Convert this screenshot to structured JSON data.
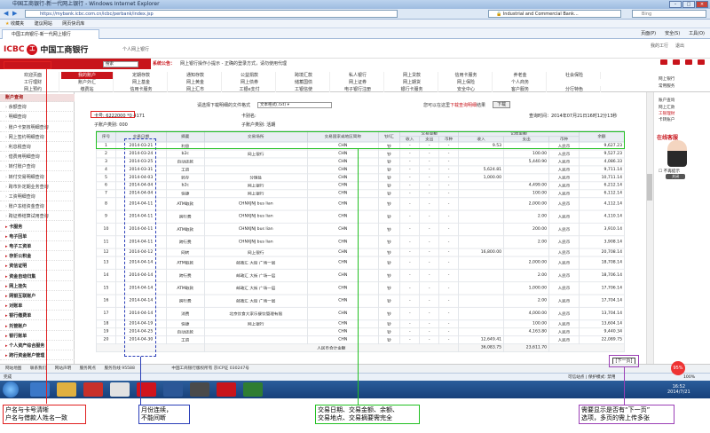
{
  "browser": {
    "window_title": "中国工商银行-新一代网上银行 - Windows Internet Explorer",
    "address": "https://mybank.icbc.com.cn/icbc/perbank/index.jsp",
    "cert_text": "Industrial and Commercial Bank...",
    "search_placeholder": "Bing",
    "favorites": [
      "收藏夹",
      "建议网站",
      "网页快讯库"
    ],
    "tab_title": "中国工商银行-新一代网上银行",
    "commands": [
      "页面(P)",
      "安全(S)",
      "工具(O)"
    ]
  },
  "header": {
    "logo_cn": "中国工商银行",
    "logo_en": "ICBC",
    "greeting": "个人网上银行",
    "links": [
      "我的工行",
      "退出"
    ],
    "search_label": "搜索",
    "notice_label": "系统公告：",
    "notice_text": "网上银行操作小提示 - 正确的登录方式，请勿使用代理"
  },
  "nav": {
    "row1": [
      "欢迎页面",
      "我的账户",
      "定期存款",
      "通知存款",
      "公益捐款",
      "跨境汇款",
      "私人银行",
      "网上贷款",
      "信用卡服务",
      "养老金",
      "社会保险"
    ],
    "row2": [
      "工行理财",
      "账户外汇",
      "网上基金",
      "网上黄金",
      "网上债券",
      "储蓄国债",
      "网上证券",
      "网上期货",
      "网上保险",
      "个人商务"
    ],
    "row3": [
      "网上预约",
      "缴费站",
      "信用卡服务",
      "网上汇市",
      "工银e支付",
      "工银信使",
      "电子银行注册",
      "银行卡服务",
      "安全中心",
      "客户服务",
      "分行特色"
    ],
    "active": "我的账户"
  },
  "sidebar": {
    "items": [
      {
        "label": "账户查询",
        "kind": "head"
      },
      {
        "label": "余额查询",
        "kind": "sub"
      },
      {
        "label": "明细查询",
        "kind": "sub"
      },
      {
        "label": "账户卡复核明细查询",
        "kind": "sub"
      },
      {
        "label": "网上签约明细查询",
        "kind": "sub"
      },
      {
        "label": "利息税查询",
        "kind": "sub"
      },
      {
        "label": "借费用明细查询",
        "kind": "sub"
      },
      {
        "label": "转付账户查询",
        "kind": "sub"
      },
      {
        "label": "转付交易明细查询",
        "kind": "sub"
      },
      {
        "label": "跨市外定期业务查询",
        "kind": "sub"
      },
      {
        "label": "工资明细查询",
        "kind": "sub"
      },
      {
        "label": "账户冻结资金查询",
        "kind": "sub"
      },
      {
        "label": "跨证券结算试用查询",
        "kind": "sub"
      },
      {
        "label": "卡服务",
        "kind": "sec"
      },
      {
        "label": "电子回单",
        "kind": "sec"
      },
      {
        "label": "电子工资单",
        "kind": "sec"
      },
      {
        "label": "存折公积金",
        "kind": "sec"
      },
      {
        "label": "资信证明",
        "kind": "sec"
      },
      {
        "label": "资金自动归集",
        "kind": "sec"
      },
      {
        "label": "网上挂失",
        "kind": "sec"
      },
      {
        "label": "网银互联账户",
        "kind": "sec"
      },
      {
        "label": "对账单",
        "kind": "sec"
      },
      {
        "label": "银行缴费单",
        "kind": "sec"
      },
      {
        "label": "托管账户",
        "kind": "sec"
      },
      {
        "label": "银行账单",
        "kind": "sec"
      },
      {
        "label": "个人资产综合服务",
        "kind": "sec"
      },
      {
        "label": "跨行资金账户管理",
        "kind": "sec"
      }
    ]
  },
  "main": {
    "download_label": "请选择下载明细的文件格式",
    "download_format": "文本格式(.txt)",
    "download_tip_pre": "您可以在这里",
    "download_tip_link": "下载查询明细",
    "download_tip_post": "结果",
    "download_button": "下载",
    "account_no": "卡号: 6222000 *0 4171",
    "account_type": "子账户类别: 000",
    "account_alias": "卡别名:",
    "account_kind": "子账户类别: 活期",
    "query_time": "查询时间：2014年07月21日16时12分13秒",
    "columns": {
      "no": "序号",
      "date": "交易日期",
      "summary": "摘要",
      "place": "交易场所",
      "country": "交易国家或地区简称",
      "cash": "钞/汇",
      "txn_amount": "交易金额",
      "rec_amount": "记账金额",
      "income": "收入",
      "expense": "支出",
      "currency": "币种",
      "balance": "余额"
    },
    "rows": [
      {
        "no": "1",
        "date": "2014-03-21",
        "summary": "利息",
        "place": "",
        "country": "CHN",
        "cash": "钞",
        "t_in": "-",
        "t_out": "-",
        "t_cur": "-",
        "r_in": "9.53",
        "r_out": "",
        "r_cur": "人民币",
        "balance": "9,627.23"
      },
      {
        "no": "2",
        "date": "2014-03-24",
        "summary": "b2c",
        "place": "网上银行",
        "country": "CHN",
        "cash": "钞",
        "t_in": "-",
        "t_out": "-",
        "t_cur": "-",
        "r_in": "",
        "r_out": "100.00",
        "r_cur": "人民币",
        "balance": "9,527.23"
      },
      {
        "no": "3",
        "date": "2014-03-25",
        "summary": "自动还款",
        "place": "",
        "country": "CHN",
        "cash": "钞",
        "t_in": "-",
        "t_out": "-",
        "t_cur": "-",
        "r_in": "",
        "r_out": "5,440.90",
        "r_cur": "人民币",
        "balance": "4,086.33"
      },
      {
        "no": "4",
        "date": "2014-03-31",
        "summary": "工资",
        "place": "",
        "country": "CHN",
        "cash": "钞",
        "t_in": "-",
        "t_out": "-",
        "t_cur": "-",
        "r_in": "5,624.81",
        "r_out": "",
        "r_cur": "人民币",
        "balance": "9,711.14"
      },
      {
        "no": "5",
        "date": "2014-04-03",
        "summary": "转存",
        "place": "分理处",
        "country": "CHN",
        "cash": "钞",
        "t_in": "-",
        "t_out": "-",
        "t_cur": "-",
        "r_in": "1,000.00",
        "r_out": "",
        "r_cur": "人民币",
        "balance": "10,711.14"
      },
      {
        "no": "6",
        "date": "2014-04-04",
        "summary": "b2c",
        "place": "网上银行",
        "country": "CHN",
        "cash": "钞",
        "t_in": "-",
        "t_out": "-",
        "t_cur": "-",
        "r_in": "",
        "r_out": "4,499.00",
        "r_cur": "人民币",
        "balance": "6,212.14"
      },
      {
        "no": "7",
        "date": "2014-04-04",
        "summary": "快捷",
        "place": "网上银行",
        "country": "CHN",
        "cash": "钞",
        "t_in": "-",
        "t_out": "-",
        "t_cur": "-",
        "r_in": "",
        "r_out": "100.00",
        "r_cur": "人民币",
        "balance": "6,112.14"
      },
      {
        "no": "8",
        "date": "2014-04-11",
        "summary": "ATM取款",
        "place": "CHNXJNJ bus lian",
        "country": "CHN",
        "cash": "钞",
        "t_in": "-",
        "t_out": "-",
        "t_cur": "-",
        "r_in": "",
        "r_out": "2,000.00",
        "r_cur": "人民币",
        "balance": "4,112.14"
      },
      {
        "no": "9",
        "date": "2014-04-11",
        "summary": "跨行费",
        "place": "CHNXJNJ bus lian",
        "country": "CHN",
        "cash": "钞",
        "t_in": "-",
        "t_out": "-",
        "t_cur": "-",
        "r_in": "",
        "r_out": "2.00",
        "r_cur": "人民币",
        "balance": "4,110.14"
      },
      {
        "no": "10",
        "date": "2014-04-11",
        "summary": "ATM取款",
        "place": "CHNXJNJ bus lian",
        "country": "CHN",
        "cash": "钞",
        "t_in": "-",
        "t_out": "-",
        "t_cur": "-",
        "r_in": "",
        "r_out": "200.00",
        "r_cur": "人民币",
        "balance": "3,910.14"
      },
      {
        "no": "11",
        "date": "2014-04-11",
        "summary": "跨行费",
        "place": "CHNXJNJ bus lian",
        "country": "CHN",
        "cash": "钞",
        "t_in": "-",
        "t_out": "-",
        "t_cur": "-",
        "r_in": "",
        "r_out": "2.00",
        "r_cur": "人民币",
        "balance": "3,908.14"
      },
      {
        "no": "12",
        "date": "2014-04-12",
        "summary": "网转",
        "place": "网上银行",
        "country": "CHN",
        "cash": "钞",
        "t_in": "-",
        "t_out": "-",
        "t_cur": "-",
        "r_in": "16,800.00",
        "r_out": "",
        "r_cur": "人民币",
        "balance": "20,708.14"
      },
      {
        "no": "13",
        "date": "2014-04-14",
        "summary": "ATM取款",
        "place": "邮政汇 大街 广场一层",
        "country": "CHN",
        "cash": "钞",
        "t_in": "-",
        "t_out": "-",
        "t_cur": "-",
        "r_in": "",
        "r_out": "2,000.00",
        "r_cur": "人民币",
        "balance": "18,708.14"
      },
      {
        "no": "14",
        "date": "2014-04-14",
        "summary": "跨行费",
        "place": "邮政汇 大街 广场一层",
        "country": "CHN",
        "cash": "钞",
        "t_in": "-",
        "t_out": "-",
        "t_cur": "-",
        "r_in": "",
        "r_out": "2.00",
        "r_cur": "人民币",
        "balance": "18,706.14"
      },
      {
        "no": "15",
        "date": "2014-04-14",
        "summary": "ATM取款",
        "place": "邮政汇 大街 广场一层",
        "country": "CHN",
        "cash": "钞",
        "t_in": "-",
        "t_out": "-",
        "t_cur": "-",
        "r_in": "",
        "r_out": "1,000.00",
        "r_cur": "人民币",
        "balance": "17,706.14"
      },
      {
        "no": "16",
        "date": "2014-04-14",
        "summary": "跨行费",
        "place": "邮政汇 大街 广场一层",
        "country": "CHN",
        "cash": "钞",
        "t_in": "-",
        "t_out": "-",
        "t_cur": "-",
        "r_in": "",
        "r_out": "2.00",
        "r_cur": "人民币",
        "balance": "17,704.14"
      },
      {
        "no": "17",
        "date": "2014-04-14",
        "summary": "消费",
        "place": "北京饮食大家乐餐饮管理有限",
        "country": "CHN",
        "cash": "钞",
        "t_in": "-",
        "t_out": "-",
        "t_cur": "-",
        "r_in": "",
        "r_out": "4,000.00",
        "r_cur": "人民币",
        "balance": "13,704.14"
      },
      {
        "no": "18",
        "date": "2014-04-19",
        "summary": "快捷",
        "place": "网上银行",
        "country": "CHN",
        "cash": "钞",
        "t_in": "-",
        "t_out": "-",
        "t_cur": "-",
        "r_in": "",
        "r_out": "100.00",
        "r_cur": "人民币",
        "balance": "13,604.14"
      },
      {
        "no": "19",
        "date": "2014-04-25",
        "summary": "自动还款",
        "place": "",
        "country": "CHN",
        "cash": "钞",
        "t_in": "-",
        "t_out": "-",
        "t_cur": "-",
        "r_in": "",
        "r_out": "4,163.80",
        "r_cur": "人民币",
        "balance": "9,440.34"
      },
      {
        "no": "20",
        "date": "2014-04-30",
        "summary": "工资",
        "place": "",
        "country": "CHN",
        "cash": "钞",
        "t_in": "-",
        "t_out": "-",
        "t_cur": "-",
        "r_in": "12,649.41",
        "r_out": "",
        "r_cur": "人民币",
        "balance": "22,089.75"
      }
    ],
    "total_label": "人民币合计金额",
    "total_in": "36,083.75",
    "total_out": "23,611.70",
    "next_button": "[下一页]"
  },
  "right_panel": {
    "items": [
      "网上银行",
      "常用服务",
      "账户查询",
      "网上汇款",
      "工银理财",
      "卡转账户",
      "通知存款",
      "网上缴费",
      "网上证券",
      "网上基金",
      "网上保险",
      "外汇买卖"
    ],
    "highlighted": [
      "工银理财"
    ],
    "cs_title": "在线客服",
    "cs_check": "不再提示",
    "cs_button": "关闭"
  },
  "footer": {
    "links": [
      "网站地图",
      "联系我们",
      "网站声明",
      "服务网点",
      "服务热线 95588"
    ],
    "copyright": "中国工商银行版权所有  京ICP证 030247号"
  },
  "statusbar": {
    "text": "完成",
    "zone": "可信站点 | 保护模式: 禁用",
    "zoom": "100%"
  },
  "taskbar": {
    "time": "16:52",
    "date": "2014/7/21",
    "bubble": "95%"
  },
  "annotations": {
    "red": "户名与卡号清晰\n户名与借款人姓名一致",
    "blue": "月份连续，\n不能间断",
    "green": "交易日期、交易金额、余额、\n交易地点、交易摘要需完全",
    "purple": "需要显示是否有“下一页”\n选项，多页的需上传多张"
  },
  "colors": {
    "brand_red": "#c8141b",
    "anno_red": "#e02020",
    "anno_blue": "#2b3fb8",
    "anno_green": "#22c022",
    "anno_purple": "#9b3fb6"
  }
}
